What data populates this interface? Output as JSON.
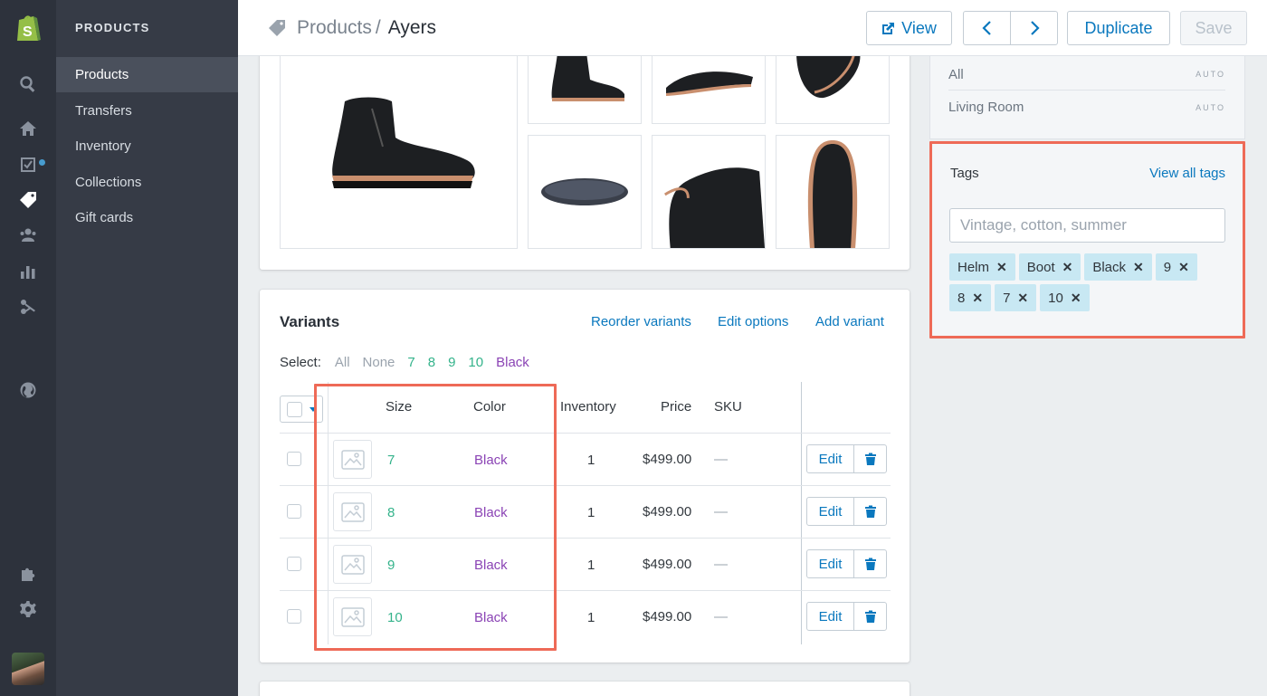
{
  "subnav": {
    "title": "PRODUCTS",
    "items": [
      {
        "label": "Products"
      },
      {
        "label": "Transfers"
      },
      {
        "label": "Inventory"
      },
      {
        "label": "Collections"
      },
      {
        "label": "Gift cards"
      }
    ]
  },
  "header": {
    "breadcrumb_parent": "Products",
    "breadcrumb_sep": "/",
    "title": "Ayers",
    "view_label": "View",
    "duplicate_label": "Duplicate",
    "save_label": "Save"
  },
  "variants": {
    "title": "Variants",
    "reorder_label": "Reorder variants",
    "edit_options_label": "Edit options",
    "add_variant_label": "Add variant",
    "select_label": "Select:",
    "select_options": [
      "All",
      "None",
      "7",
      "8",
      "9",
      "10",
      "Black"
    ],
    "columns": [
      "Size",
      "Color",
      "Inventory",
      "Price",
      "SKU"
    ],
    "rows": [
      {
        "size": "7",
        "color": "Black",
        "inventory": "1",
        "price": "$499.00",
        "sku": "—",
        "edit": "Edit"
      },
      {
        "size": "8",
        "color": "Black",
        "inventory": "1",
        "price": "$499.00",
        "sku": "—",
        "edit": "Edit"
      },
      {
        "size": "9",
        "color": "Black",
        "inventory": "1",
        "price": "$499.00",
        "sku": "—",
        "edit": "Edit"
      },
      {
        "size": "10",
        "color": "Black",
        "inventory": "1",
        "price": "$499.00",
        "sku": "—",
        "edit": "Edit"
      }
    ]
  },
  "collections": {
    "items": [
      {
        "label": "All",
        "badge": "AUTO"
      },
      {
        "label": "Living Room",
        "badge": "AUTO"
      }
    ]
  },
  "tags": {
    "title": "Tags",
    "view_all_label": "View all tags",
    "placeholder": "Vintage, cotton, summer",
    "items": [
      "Helm",
      "Boot",
      "Black",
      "9",
      "8",
      "7",
      "10"
    ],
    "remove_glyph": "✕"
  },
  "colors": {
    "accent": "#0a78be",
    "size_green": "#34b38b",
    "color_purple": "#8b44b5",
    "highlight": "#ee6a57",
    "tag_bg": "#c8e8f3"
  }
}
